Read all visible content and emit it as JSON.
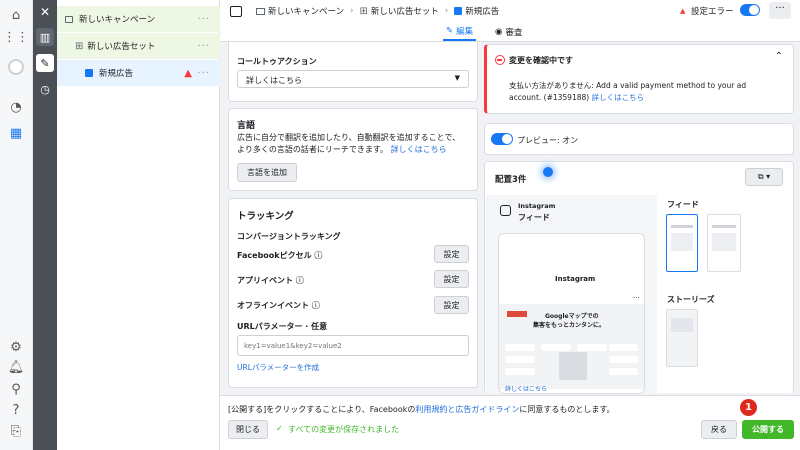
{
  "breadcrumb": {
    "campaign": "新しいキャンペーン",
    "adset": "新しい広告セット",
    "ad": "新規広告",
    "status": "設定エラー"
  },
  "tree": {
    "campaign": "新しいキャンペーン",
    "adset": "新しい広告セット",
    "ad": "新規広告"
  },
  "tabs": {
    "edit": "編集",
    "review": "審査"
  },
  "cta": {
    "title": "コールトゥアクション",
    "value": "詳しくはこちら"
  },
  "language": {
    "title": "言語",
    "desc1": "広告に自分で翻訳を追加したり、自動翻訳を追加することで、",
    "desc2": "より多くの言語の話者にリーチできます。",
    "link": "詳しくはこちら",
    "button": "言語を追加"
  },
  "tracking": {
    "title": "トラッキング",
    "subtitle": "コンバージョントラッキング",
    "pixel": "Facebookピクセル",
    "app": "アプリイベント",
    "offline": "オフラインイベント",
    "setting": "設定",
    "url_label": "URLパラメーター · 任意",
    "url_placeholder": "key1=value1&key2=value2",
    "url_link": "URLパラメーターを作成"
  },
  "review": {
    "title": "変更を確認中です",
    "text1": "支払い方法がありません: Add a valid payment method to your ad",
    "text2": "account. (#1359188)",
    "link": "詳しくはこちら"
  },
  "preview": {
    "toggle": "プレビュー: オン",
    "placements": "配置3件",
    "ig_label": "Instagram",
    "ig_feed": "フィード",
    "feed_heading": "フィード",
    "stories_heading": "ストーリーズ",
    "mock_logo": "Instagram",
    "mock_line1": "Googleマップでの",
    "mock_line2": "集客をもっとカンタンに。",
    "mock_link": "詳しくはこちら"
  },
  "footer": {
    "notice_pre": "[公開する]をクリックすることにより、Facebookの",
    "notice_link": "利用規約と広告ガイドライン",
    "notice_post": "に同意するものとします。",
    "close": "閉じる",
    "saved": "すべての変更が保存されました",
    "back": "戻る",
    "publish": "公開する",
    "badge": "1"
  },
  "colors": {
    "brand": "#1877f2",
    "green": "#42b72a",
    "error": "#fa383e"
  }
}
